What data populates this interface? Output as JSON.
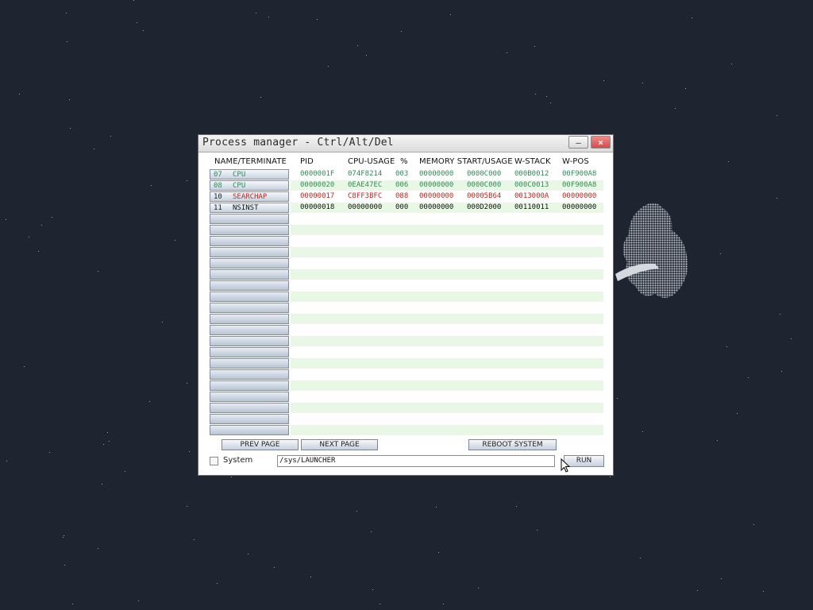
{
  "window": {
    "title": "Process manager - Ctrl/Alt/Del",
    "minimize_glyph": "—",
    "close_glyph": "×"
  },
  "headers": {
    "name": "NAME/TERMINATE",
    "pid": "PID",
    "cpu_usage": "CPU-USAGE",
    "percent": "%",
    "memory": "MEMORY START/USAGE",
    "w_stack": "W-STACK",
    "w_pos": "W-POS"
  },
  "processes": [
    {
      "num": "07",
      "name": "CPU",
      "pid": "0000001F",
      "cpu": "074F8214",
      "pct": "003",
      "mem_start": "00000000",
      "mem_usage": "0000C000",
      "w_stack": "000B0012",
      "w_pos": "00F900A8",
      "color": "#2e8b57"
    },
    {
      "num": "08",
      "name": "CPU",
      "pid": "00000020",
      "cpu": "0EAE47EC",
      "pct": "006",
      "mem_start": "00000000",
      "mem_usage": "0000C000",
      "w_stack": "000C0013",
      "w_pos": "00F900A8",
      "color": "#2e8b57"
    },
    {
      "num": "10",
      "name": "SEARCHAP",
      "pid": "00000017",
      "cpu": "C8FF3BFC",
      "pct": "088",
      "mem_start": "00000000",
      "mem_usage": "00005B64",
      "w_stack": "0013000A",
      "w_pos": "00000000",
      "color": "#c0261c"
    },
    {
      "num": "11",
      "name": "NSINST",
      "pid": "00000018",
      "cpu": "00000000",
      "pct": "000",
      "mem_start": "00000000",
      "mem_usage": "000D2000",
      "w_stack": "00110011",
      "w_pos": "00000000",
      "color": "#111111"
    }
  ],
  "empty_row_count": 20,
  "buttons": {
    "prev_page": "PREV PAGE",
    "next_page": "NEXT PAGE",
    "reboot": "REBOOT SYSTEM",
    "run": "RUN"
  },
  "system_checkbox_label": "System",
  "command_input_value": "/sys/LAUNCHER",
  "colors": {
    "desktop": "#1e2530",
    "row_stripe": "#e8f8e4",
    "running_text": "#2e8b57",
    "alert_text": "#c0261c"
  }
}
